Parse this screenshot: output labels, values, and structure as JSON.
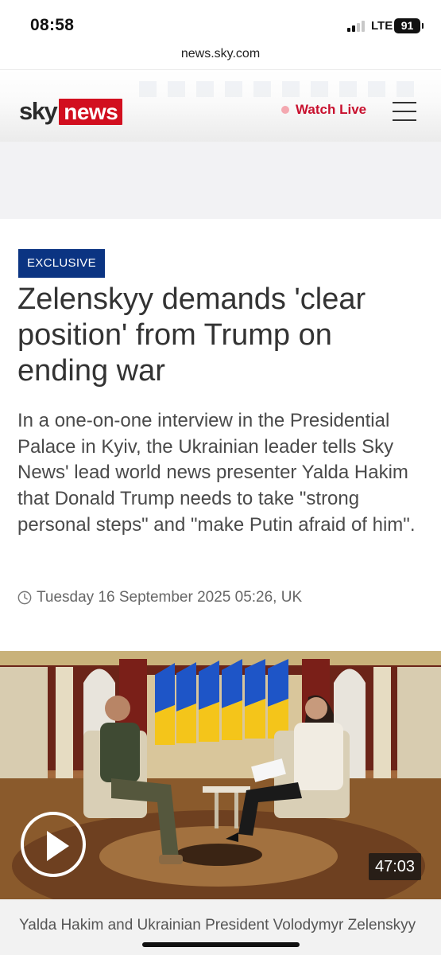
{
  "status_bar": {
    "time": "08:58",
    "network": "LTE",
    "battery": "91"
  },
  "browser": {
    "url": "news.sky.com"
  },
  "header": {
    "logo_sky": "sky",
    "logo_news": "news",
    "watch_live": "Watch Live"
  },
  "article": {
    "badge": "EXCLUSIVE",
    "headline": "Zelenskyy demands 'clear position' from Trump on ending war",
    "standfirst": "In a one-on-one interview in the Presidential Palace in Kyiv, the Ukrainian leader tells Sky News' lead world news presenter Yalda Hakim that Donald Trump needs to take \"strong personal steps\" and \"make Putin afraid of him\".",
    "timestamp": "Tuesday 16 September 2025 05:26, UK"
  },
  "video": {
    "duration": "47:03",
    "caption": "Yalda Hakim and Ukrainian President Volodymyr Zelenskyy"
  },
  "colors": {
    "brand_red": "#d20f1f",
    "badge_blue": "#0b3482",
    "ukraine_blue": "#1e55c7",
    "ukraine_yellow": "#f4c51a"
  }
}
